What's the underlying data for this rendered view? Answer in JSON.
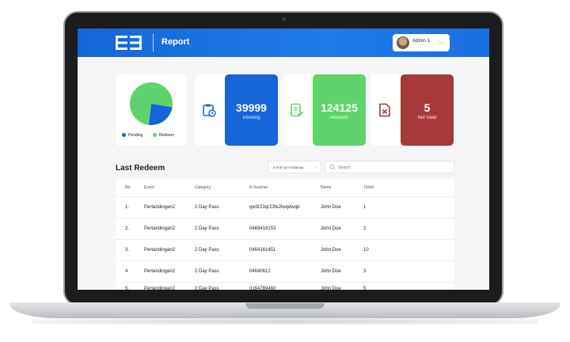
{
  "header": {
    "title": "Report",
    "user_name": "Admin 1"
  },
  "summary": {
    "pie": {
      "legend": [
        "Pending",
        "Redeem"
      ],
      "colors": [
        "#1565d8",
        "#5fd36b"
      ]
    },
    "pending": {
      "value": "39999",
      "label": "Pending",
      "color": "#1565d8"
    },
    "redeem": {
      "value": "124125",
      "label": "Redeem",
      "color": "#5fd36b"
    },
    "not_valid": {
      "value": "5",
      "label": "Not Valid",
      "color": "#a8393b"
    }
  },
  "chart_data": {
    "type": "pie",
    "categories": [
      "Pending",
      "Redeem"
    ],
    "values": [
      39999,
      124125
    ]
  },
  "last_redeem": {
    "title": "Last Redeem",
    "select_value": "5 entri per halaman",
    "search_placeholder": "Search",
    "columns": [
      "No.",
      "Event",
      "Category",
      "E-Voucher",
      "Name",
      "Ticket"
    ],
    "rows": [
      [
        "1.",
        "Pertandingan2",
        "2 Day Pass",
        "qw3r23qr23fe2lwqdwqd",
        "John Doe",
        "1"
      ],
      [
        "2.",
        "Pertandingan2",
        "2 Day Pass",
        "0469418153",
        "John Doe",
        "2"
      ],
      [
        "3.",
        "Pertandingan2",
        "2 Day Pass",
        "0464161451",
        "John Doe",
        "10"
      ],
      [
        "4.",
        "Pertandingan2",
        "2 Day Pass",
        "04640612",
        "John Doe",
        "3"
      ],
      [
        "5.",
        "Pertandingan2",
        "2 Day Pass",
        "0164789460",
        "John Doe",
        "5"
      ]
    ]
  }
}
